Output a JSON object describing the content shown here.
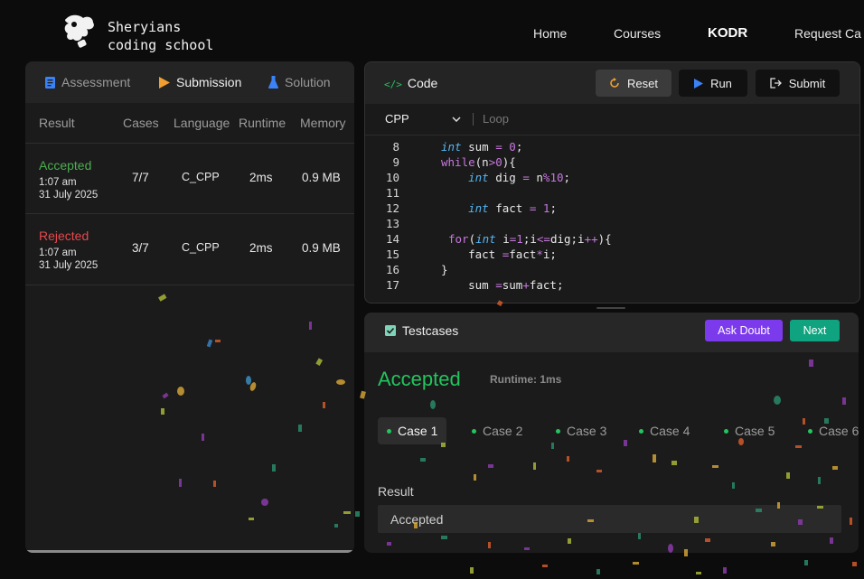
{
  "header": {
    "brand_line1": "Sheryians",
    "brand_line2": "coding school",
    "nav": [
      "Home",
      "Courses",
      "KODR",
      "Request Ca"
    ]
  },
  "left_panel": {
    "tabs": [
      "Assessment",
      "Submission",
      "Solution"
    ],
    "active_tab": "Submission",
    "columns": [
      "Result",
      "Cases",
      "Language",
      "Runtime",
      "Memory"
    ],
    "submissions": [
      {
        "status": "Accepted",
        "time": "1:07 am",
        "date": "31 July 2025",
        "cases": "7/7",
        "language": "C_CPP",
        "runtime": "2ms",
        "memory": "0.9 MB",
        "color": "#4caf50"
      },
      {
        "status": "Rejected",
        "time": "1:07 am",
        "date": "31 July 2025",
        "cases": "3/7",
        "language": "C_CPP",
        "runtime": "2ms",
        "memory": "0.9 MB",
        "color": "#e5484d"
      }
    ]
  },
  "code_panel": {
    "title": "Code",
    "reset_label": "Reset",
    "run_label": "Run",
    "submit_label": "Submit",
    "language": "CPP",
    "problem": "Loop",
    "line_numbers": [
      "8",
      "9",
      "10",
      "11",
      "12",
      "13",
      "14",
      "15",
      "16",
      "17"
    ]
  },
  "testcases": {
    "title": "Testcases",
    "ask_doubt_label": "Ask Doubt",
    "next_label": "Next",
    "verdict": "Accepted",
    "runtime": "Runtime: 1ms",
    "cases": [
      "Case 1",
      "Case 2",
      "Case 3",
      "Case 4",
      "Case 5",
      "Case 6"
    ],
    "active_case": "Case 1",
    "result_label": "Result",
    "result_value": "Accepted"
  },
  "colors": {
    "accepted": "#22c55e",
    "rejected": "#e5484d",
    "ask_doubt": "#7c3aed",
    "next": "#0fa37f"
  }
}
